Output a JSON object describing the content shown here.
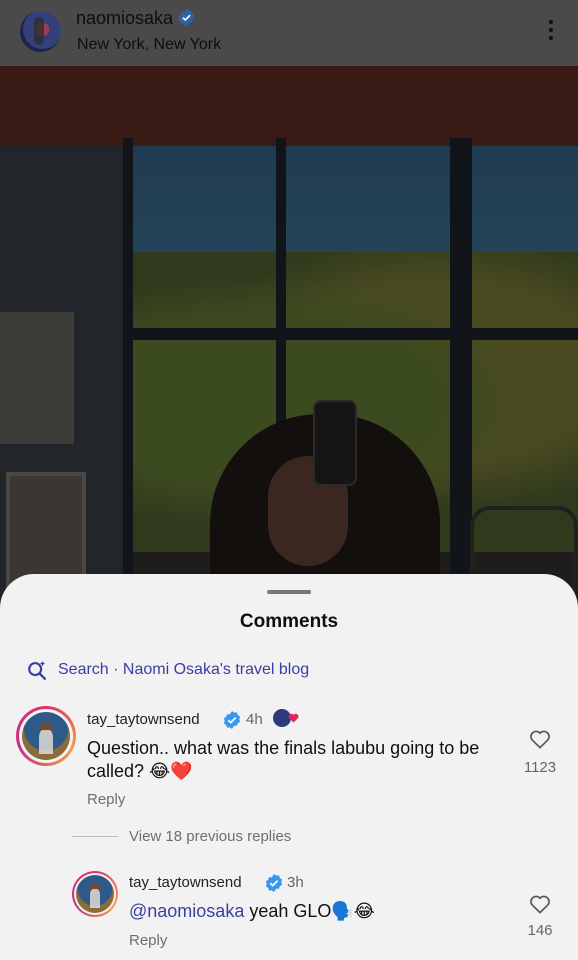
{
  "header": {
    "username": "naomiosaka",
    "location": "New York, New York"
  },
  "comments_sheet": {
    "title": "Comments",
    "search_label": "Search · Naomi Osaka's travel blog"
  },
  "comments": [
    {
      "username": "tay_taytownsend",
      "time": "4h",
      "text": "Question.. what was the finals labubu going to be called? 😂❤️",
      "reply_label": "Reply",
      "likes": "1123"
    }
  ],
  "view_replies": "View 18 previous replies",
  "replies": [
    {
      "username": "tay_taytownsend",
      "time": "3h",
      "mention": "@naomiosaka",
      "text": " yeah GLO🗣️😂",
      "reply_label": "Reply",
      "likes": "146"
    }
  ],
  "colors": {
    "verified": "#3897f0",
    "mention": "#3b3fa0",
    "sheet_bg": "#f2f2f2"
  }
}
